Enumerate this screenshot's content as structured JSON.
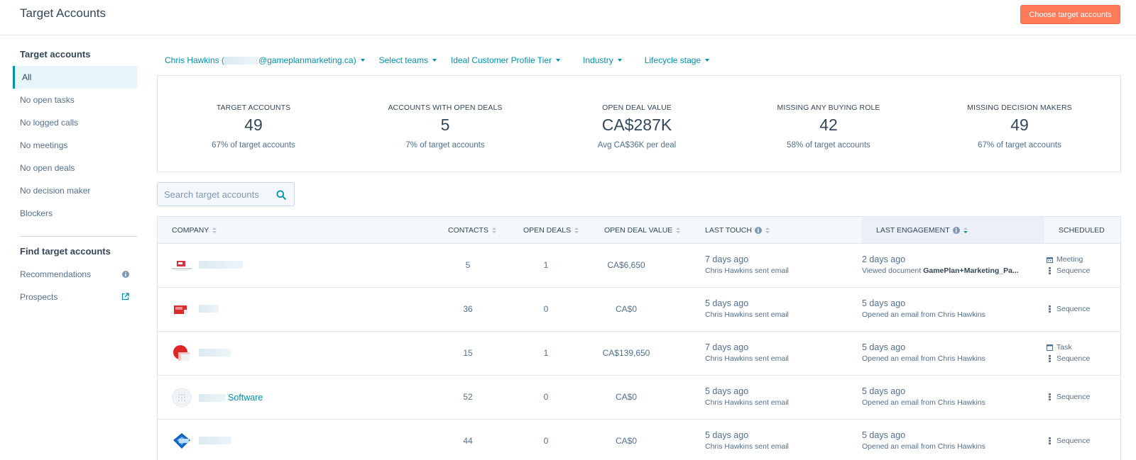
{
  "page": {
    "title": "Target Accounts",
    "cta_label": "Choose target accounts"
  },
  "colors": {
    "accent": "#0091ae",
    "cta": "#ff7a59",
    "text": "#33475b",
    "muted": "#516f90"
  },
  "sidebar": {
    "section1_title": "Target accounts",
    "items": [
      {
        "label": "All"
      },
      {
        "label": "No open tasks"
      },
      {
        "label": "No logged calls"
      },
      {
        "label": "No meetings"
      },
      {
        "label": "No open deals"
      },
      {
        "label": "No decision maker"
      },
      {
        "label": "Blockers"
      }
    ],
    "section2_title": "Find target accounts",
    "items2": [
      {
        "label": "Recommendations",
        "icon": "info-icon"
      },
      {
        "label": "Prospects",
        "icon": "external-link-icon"
      }
    ]
  },
  "filters": {
    "owner_prefix": "Chris Hawkins (",
    "owner_suffix": "@gameplanmarketing.ca)",
    "teams": "Select teams",
    "icp": "Ideal Customer Profile Tier",
    "industry": "Industry",
    "lifecycle": "Lifecycle stage"
  },
  "stats": [
    {
      "label": "TARGET ACCOUNTS",
      "value": "49",
      "sub": "67% of target accounts"
    },
    {
      "label": "ACCOUNTS WITH OPEN DEALS",
      "value": "5",
      "sub": "7% of target accounts"
    },
    {
      "label": "OPEN DEAL VALUE",
      "value": "CA$287K",
      "sub": "Avg CA$36K per deal"
    },
    {
      "label": "MISSING ANY BUYING ROLE",
      "value": "42",
      "sub": "58% of target accounts"
    },
    {
      "label": "MISSING DECISION MAKERS",
      "value": "49",
      "sub": "67% of target accounts"
    }
  ],
  "search": {
    "placeholder": "Search target accounts"
  },
  "table": {
    "headers": {
      "company": "COMPANY",
      "contacts": "CONTACTS",
      "open_deals": "OPEN DEALS",
      "open_deal_value": "OPEN DEAL VALUE",
      "last_touch": "LAST TOUCH",
      "last_engagement": "LAST ENGAGEMENT",
      "scheduled": "SCHEDULED"
    },
    "rows": [
      {
        "company": "",
        "contacts": "5",
        "open_deals": "1",
        "value": "CA$6,650",
        "touch_when": "7 days ago",
        "touch_what": "Chris Hawkins sent email",
        "eng_when": "2 days ago",
        "eng_prefix": "Viewed document ",
        "eng_doc": "GamePlan+Marketing_Pa...",
        "eng_what": "",
        "scheduled": [
          "Meeting",
          "Sequence"
        ]
      },
      {
        "company": "",
        "contacts": "36",
        "open_deals": "0",
        "value": "CA$0",
        "touch_when": "5 days ago",
        "touch_what": "Chris Hawkins sent email",
        "eng_when": "5 days ago",
        "eng_what": "Opened an email from Chris Hawkins",
        "scheduled": [
          "Sequence"
        ]
      },
      {
        "company": "",
        "contacts": "15",
        "open_deals": "1",
        "value": "CA$139,650",
        "touch_when": "7 days ago",
        "touch_what": "Chris Hawkins sent email",
        "eng_when": "5 days ago",
        "eng_what": "Opened an email from Chris Hawkins",
        "scheduled": [
          "Task",
          "Sequence"
        ]
      },
      {
        "company": "Software",
        "contacts": "52",
        "open_deals": "0",
        "value": "CA$0",
        "touch_when": "5 days ago",
        "touch_what": "Chris Hawkins sent email",
        "eng_when": "5 days ago",
        "eng_what": "Opened an email from Chris Hawkins",
        "scheduled": [
          "Sequence"
        ]
      },
      {
        "company": "",
        "contacts": "44",
        "open_deals": "0",
        "value": "CA$0",
        "touch_when": "5 days ago",
        "touch_what": "Chris Hawkins sent email",
        "eng_when": "5 days ago",
        "eng_what": "Opened an email from Chris Hawkins",
        "scheduled": [
          "Sequence"
        ]
      }
    ]
  }
}
